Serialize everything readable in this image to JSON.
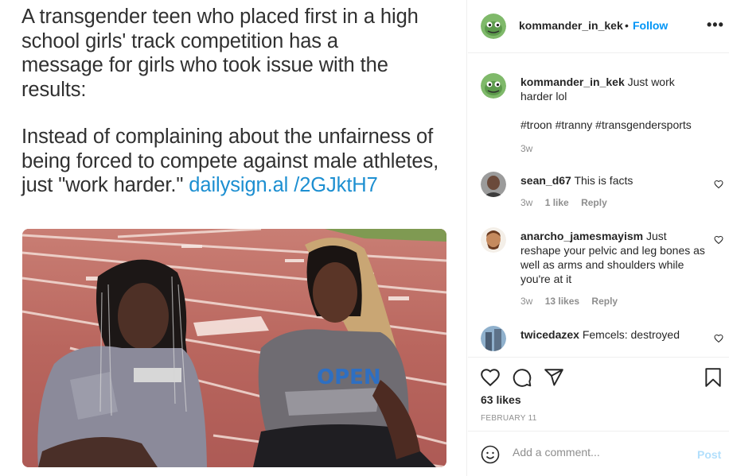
{
  "image": {
    "headline": "A transgender teen who placed first in a high\nschool girls' track competition has a\nmessage for girls who took issue with the\nresults:",
    "body_text": "Instead of complaining about the unfairness of being forced to compete against male athletes, just \"work harder.\" ",
    "link_text": "dailysign.al /2GJktH7",
    "shirt_text": "OPEN"
  },
  "header": {
    "username": "kommander_in_kek",
    "separator": "•",
    "follow_label": "Follow",
    "more_label": "•••"
  },
  "caption": {
    "username": "kommander_in_kek",
    "text": "Just work harder lol",
    "hashtags": "#troon #tranny #transgendersports",
    "time": "3w"
  },
  "comments": [
    {
      "username": "sean_d67",
      "text": "This is facts",
      "time": "3w",
      "likes": "1 like",
      "reply": "Reply"
    },
    {
      "username": "anarcho_jamesmayism",
      "text": "Just reshape your pelvic and leg bones as well as arms and shoulders while you're at it",
      "time": "3w",
      "likes": "13 likes",
      "reply": "Reply"
    },
    {
      "username": "twicedazex",
      "text": "Femcels: destroyed"
    }
  ],
  "actions": {
    "likes": "63 likes",
    "date": "FEBRUARY 11",
    "icons": [
      "heart-icon",
      "comment-icon",
      "share-icon",
      "bookmark-icon"
    ]
  },
  "add_comment": {
    "placeholder": "Add a comment...",
    "post_label": "Post"
  },
  "colors": {
    "accent": "#0095f6",
    "link": "#1d8fd1",
    "post_disabled": "#b2dffc",
    "hashtag": "#00376b",
    "muted": "#8e8e8e"
  }
}
